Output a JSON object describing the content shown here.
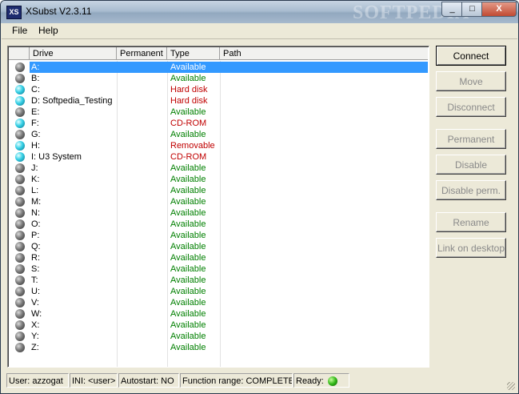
{
  "window": {
    "title": "XSubst V2.3.11",
    "icon_label": "XS",
    "watermark": "SOFTPEDIA",
    "controls": {
      "minimize": "_",
      "maximize": "□",
      "close": "X"
    }
  },
  "menu": {
    "file": "File",
    "help": "Help"
  },
  "table": {
    "headers": {
      "drive": "Drive",
      "permanent": "Permanent",
      "type": "Type",
      "path": "Path"
    },
    "rows": [
      {
        "drive": "A:",
        "permanent": "",
        "type": "Available",
        "path": "",
        "icon": "grey",
        "selected": true
      },
      {
        "drive": "B:",
        "permanent": "",
        "type": "Available",
        "path": "",
        "icon": "grey"
      },
      {
        "drive": "C:",
        "permanent": "",
        "type": "Hard disk",
        "path": "",
        "icon": "cyan"
      },
      {
        "drive": "D:  Softpedia_Testing",
        "permanent": "",
        "type": "Hard disk",
        "path": "",
        "icon": "cyan"
      },
      {
        "drive": "E:",
        "permanent": "",
        "type": "Available",
        "path": "",
        "icon": "grey"
      },
      {
        "drive": "F:",
        "permanent": "",
        "type": "CD-ROM",
        "path": "",
        "icon": "cyan"
      },
      {
        "drive": "G:",
        "permanent": "",
        "type": "Available",
        "path": "",
        "icon": "grey"
      },
      {
        "drive": "H:",
        "permanent": "",
        "type": "Removable",
        "path": "",
        "icon": "cyan"
      },
      {
        "drive": "I:  U3 System",
        "permanent": "",
        "type": "CD-ROM",
        "path": "",
        "icon": "cyan"
      },
      {
        "drive": "J:",
        "permanent": "",
        "type": "Available",
        "path": "",
        "icon": "grey"
      },
      {
        "drive": "K:",
        "permanent": "",
        "type": "Available",
        "path": "",
        "icon": "grey"
      },
      {
        "drive": "L:",
        "permanent": "",
        "type": "Available",
        "path": "",
        "icon": "grey"
      },
      {
        "drive": "M:",
        "permanent": "",
        "type": "Available",
        "path": "",
        "icon": "grey"
      },
      {
        "drive": "N:",
        "permanent": "",
        "type": "Available",
        "path": "",
        "icon": "grey"
      },
      {
        "drive": "O:",
        "permanent": "",
        "type": "Available",
        "path": "",
        "icon": "grey"
      },
      {
        "drive": "P:",
        "permanent": "",
        "type": "Available",
        "path": "",
        "icon": "grey"
      },
      {
        "drive": "Q:",
        "permanent": "",
        "type": "Available",
        "path": "",
        "icon": "grey"
      },
      {
        "drive": "R:",
        "permanent": "",
        "type": "Available",
        "path": "",
        "icon": "grey"
      },
      {
        "drive": "S:",
        "permanent": "",
        "type": "Available",
        "path": "",
        "icon": "grey"
      },
      {
        "drive": "T:",
        "permanent": "",
        "type": "Available",
        "path": "",
        "icon": "grey"
      },
      {
        "drive": "U:",
        "permanent": "",
        "type": "Available",
        "path": "",
        "icon": "grey"
      },
      {
        "drive": "V:",
        "permanent": "",
        "type": "Available",
        "path": "",
        "icon": "grey"
      },
      {
        "drive": "W:",
        "permanent": "",
        "type": "Available",
        "path": "",
        "icon": "grey"
      },
      {
        "drive": "X:",
        "permanent": "",
        "type": "Available",
        "path": "",
        "icon": "grey"
      },
      {
        "drive": "Y:",
        "permanent": "",
        "type": "Available",
        "path": "",
        "icon": "grey"
      },
      {
        "drive": "Z:",
        "permanent": "",
        "type": "Available",
        "path": "",
        "icon": "grey"
      }
    ]
  },
  "buttons": [
    {
      "name": "connect-button",
      "label": "Connect",
      "enabled": true
    },
    {
      "name": "move-button",
      "label": "Move",
      "enabled": false
    },
    {
      "name": "disconnect-button",
      "label": "Disconnect",
      "enabled": false
    },
    {
      "name": "permanent-button",
      "label": "Permanent",
      "enabled": false
    },
    {
      "name": "disable-button",
      "label": "Disable",
      "enabled": false
    },
    {
      "name": "disable-perm-button",
      "label": "Disable perm.",
      "enabled": false
    },
    {
      "name": "rename-button",
      "label": "Rename",
      "enabled": false
    },
    {
      "name": "link-on-desktop-button",
      "label": "Link on desktop",
      "enabled": false
    }
  ],
  "status": {
    "user": "User: azzogat",
    "ini": "INI: <user>",
    "autostart": "Autostart: NO",
    "function_range": "Function range: COMPLETE",
    "ready": "Ready:"
  },
  "colors": {
    "available": "#008000",
    "hard_disk": "#c00000",
    "selection": "#3399ff",
    "ready_led": "#32b818"
  }
}
